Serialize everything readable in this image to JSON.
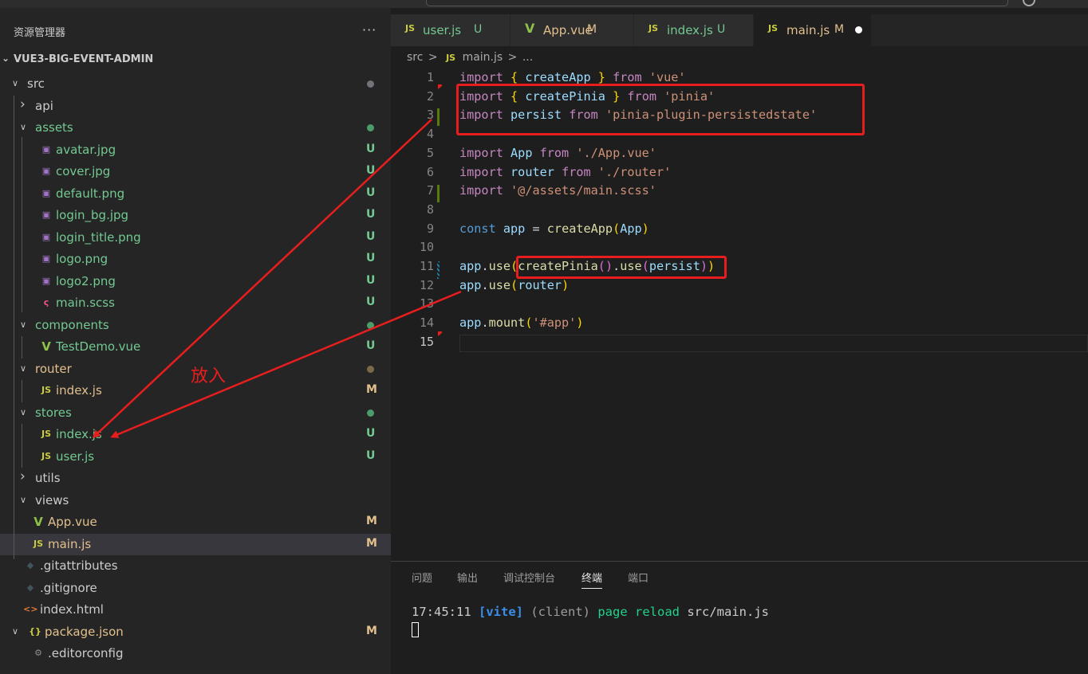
{
  "explorer": {
    "title": "资源管理器",
    "more": "···",
    "project": "VUE3-BIG-EVENT-ADMIN"
  },
  "tree": [
    {
      "label": "src",
      "type": "folder",
      "open": true,
      "depth": 0,
      "status": "dot",
      "status_color": "#73737a"
    },
    {
      "label": "api",
      "type": "folder",
      "open": false,
      "depth": 1
    },
    {
      "label": "assets",
      "type": "folder",
      "open": true,
      "depth": 1,
      "status": "dot",
      "status_color": "#4c9b6a",
      "color": "#73c991"
    },
    {
      "label": "avatar.jpg",
      "type": "image",
      "depth": 2,
      "status": "U",
      "color": "#73c991"
    },
    {
      "label": "cover.jpg",
      "type": "image",
      "depth": 2,
      "status": "U",
      "color": "#73c991"
    },
    {
      "label": "default.png",
      "type": "image",
      "depth": 2,
      "status": "U",
      "color": "#73c991"
    },
    {
      "label": "login_bg.jpg",
      "type": "image",
      "depth": 2,
      "status": "U",
      "color": "#73c991"
    },
    {
      "label": "login_title.png",
      "type": "image",
      "depth": 2,
      "status": "U",
      "color": "#73c991"
    },
    {
      "label": "logo.png",
      "type": "image",
      "depth": 2,
      "status": "U",
      "color": "#73c991"
    },
    {
      "label": "logo2.png",
      "type": "image",
      "depth": 2,
      "status": "U",
      "color": "#73c991"
    },
    {
      "label": "main.scss",
      "type": "scss",
      "depth": 2,
      "status": "U",
      "color": "#73c991"
    },
    {
      "label": "components",
      "type": "folder",
      "open": true,
      "depth": 1,
      "status": "dot",
      "status_color": "#4c9b6a",
      "color": "#73c991"
    },
    {
      "label": "TestDemo.vue",
      "type": "vue",
      "depth": 2,
      "status": "U",
      "color": "#73c991"
    },
    {
      "label": "router",
      "type": "folder",
      "open": true,
      "depth": 1,
      "status": "dot",
      "status_color": "#7b6a4a",
      "color": "#e2c08d"
    },
    {
      "label": "index.js",
      "type": "js",
      "depth": 2,
      "status": "M",
      "color": "#e2c08d"
    },
    {
      "label": "stores",
      "type": "folder",
      "open": true,
      "depth": 1,
      "status": "dot",
      "status_color": "#4c9b6a",
      "color": "#73c991"
    },
    {
      "label": "index.js",
      "type": "js",
      "depth": 2,
      "status": "U",
      "color": "#73c991"
    },
    {
      "label": "user.js",
      "type": "js",
      "depth": 2,
      "status": "U",
      "color": "#73c991"
    },
    {
      "label": "utils",
      "type": "folder",
      "open": false,
      "depth": 1
    },
    {
      "label": "views",
      "type": "folder",
      "open": true,
      "depth": 1
    },
    {
      "label": "App.vue",
      "type": "vue",
      "depth": 1,
      "status": "M",
      "color": "#e2c08d"
    },
    {
      "label": "main.js",
      "type": "js",
      "depth": 1,
      "status": "M",
      "color": "#e2c08d",
      "selected": true
    },
    {
      "label": ".gitattributes",
      "type": "git",
      "depth": 0
    },
    {
      "label": ".gitignore",
      "type": "git",
      "depth": 0
    },
    {
      "label": "index.html",
      "type": "html",
      "depth": 0
    },
    {
      "label": "package.json",
      "type": "json",
      "open": true,
      "depth": 0,
      "status": "M",
      "color": "#e2c08d"
    },
    {
      "label": ".editorconfig",
      "type": "gear",
      "depth": 1
    }
  ],
  "tabs": [
    {
      "label": "user.js",
      "icon": "JS",
      "status": "U",
      "status_color": "#73c991",
      "label_color": "#73c991"
    },
    {
      "label": "App.vue",
      "icon": "V",
      "status": "M",
      "status_color": "#e2c08d",
      "label_color": "#e2c08d"
    },
    {
      "label": "index.js",
      "icon": "JS",
      "status": "U",
      "status_color": "#73c991",
      "label_color": "#73c991"
    },
    {
      "label": "main.js",
      "icon": "JS",
      "status": "M",
      "status_color": "#e2c08d",
      "label_color": "#e2c08d",
      "active": true,
      "modified": true
    }
  ],
  "breadcrumb": {
    "folder": "src",
    "sep": ">",
    "file_icon": "JS",
    "file": "main.js",
    "tail": "..."
  },
  "code": {
    "current_line": 15,
    "lines": [
      "import { createApp } from 'vue'",
      "import { createPinia } from 'pinia'",
      "import persist from 'pinia-plugin-persistedstate'",
      "",
      "import App from './App.vue'",
      "import router from './router'",
      "import '@/assets/main.scss'",
      "",
      "const app = createApp(App)",
      "",
      "app.use(createPinia().use(persist))",
      "app.use(router)",
      "",
      "app.mount('#app')",
      ""
    ]
  },
  "panel": {
    "tabs": [
      "问题",
      "输出",
      "调试控制台",
      "终端",
      "端口"
    ],
    "active_tab": "终端",
    "terminal": {
      "time": "17:45:11",
      "tag": "[vite]",
      "scope": "(client)",
      "action": "page reload",
      "file": "src/main.js"
    }
  },
  "annotation": {
    "label": "放入",
    "color": "#e81e1e"
  }
}
